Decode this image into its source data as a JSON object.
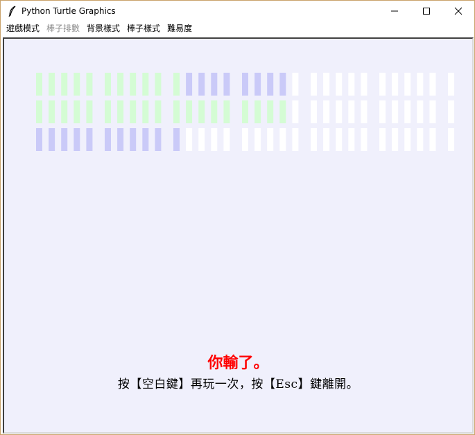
{
  "window": {
    "title": "Python Turtle Graphics",
    "controls": [
      "minimize",
      "maximize",
      "close"
    ]
  },
  "menu": {
    "items": [
      {
        "label": "遊戲模式",
        "enabled": true
      },
      {
        "label": "棒子排數",
        "enabled": false
      },
      {
        "label": "背景樣式",
        "enabled": true
      },
      {
        "label": "棒子樣式",
        "enabled": true
      },
      {
        "label": "難易度",
        "enabled": true
      }
    ]
  },
  "colors": {
    "canvas_bg": "#f0f0fc",
    "green_stick": "#d4fcd4",
    "blue_stick": "#cacaf8",
    "white_stick": "#ffffff",
    "lose_text": "#ff0000"
  },
  "game": {
    "rows": [
      [
        "g",
        "g",
        "g",
        "g",
        "g",
        "g",
        "g",
        "g",
        "g",
        "g",
        "g",
        "b",
        "b",
        "b",
        "b",
        "b",
        "b",
        "b",
        "b",
        "w",
        "w",
        "w",
        "w",
        "w",
        "w",
        "w",
        "w",
        "w",
        "w",
        "w",
        "w"
      ],
      [
        "g",
        "g",
        "g",
        "g",
        "g",
        "g",
        "g",
        "g",
        "g",
        "g",
        "g",
        "g",
        "g",
        "g",
        "g",
        "g",
        "g",
        "g",
        "g",
        "w",
        "w",
        "w",
        "w",
        "w",
        "w",
        "w",
        "w",
        "w",
        "w",
        "w",
        "w"
      ],
      [
        "b",
        "b",
        "b",
        "b",
        "b",
        "b",
        "b",
        "b",
        "b",
        "b",
        "b",
        "w",
        "w",
        "w",
        "w",
        "w",
        "w",
        "w",
        "w",
        "w",
        "w",
        "w",
        "w",
        "w",
        "w",
        "w",
        "w",
        "w",
        "w",
        "w",
        "w"
      ]
    ],
    "lose_message": "你輸了。",
    "help_message": "按【空白鍵】再玩一次，按【Esc】鍵離開。"
  }
}
